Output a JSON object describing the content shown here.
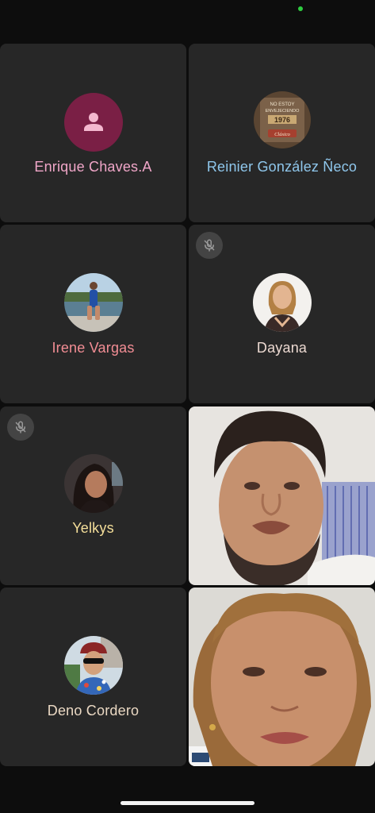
{
  "participants": [
    {
      "name": "Enrique Chaves.A",
      "name_color": "#f0a6c8",
      "avatar": "person-icon",
      "muted": false
    },
    {
      "name": "Reinier González Ñeco",
      "name_color": "#8fc7ec",
      "avatar": "profile-photo",
      "avatar_text": [
        "NO ESTOY",
        "ENVEJECIENDO",
        "1976",
        "Clásico"
      ],
      "muted": false
    },
    {
      "name": "Irene Vargas",
      "name_color": "#f28d94",
      "avatar": "profile-photo",
      "muted": false
    },
    {
      "name": "Dayana",
      "name_color": "#ecd9d1",
      "avatar": "profile-photo",
      "muted": true
    },
    {
      "name": "Yelkys",
      "name_color": "#f5df9a",
      "avatar": "profile-photo",
      "muted": true
    },
    {
      "name": "",
      "avatar": "video-feed",
      "muted": false
    },
    {
      "name": "Deno Cordero",
      "name_color": "#ead8c3",
      "avatar": "profile-photo",
      "muted": false
    },
    {
      "name": "",
      "avatar": "video-feed",
      "muted": false
    }
  ],
  "icons": {
    "mute": "mic-off-icon"
  }
}
